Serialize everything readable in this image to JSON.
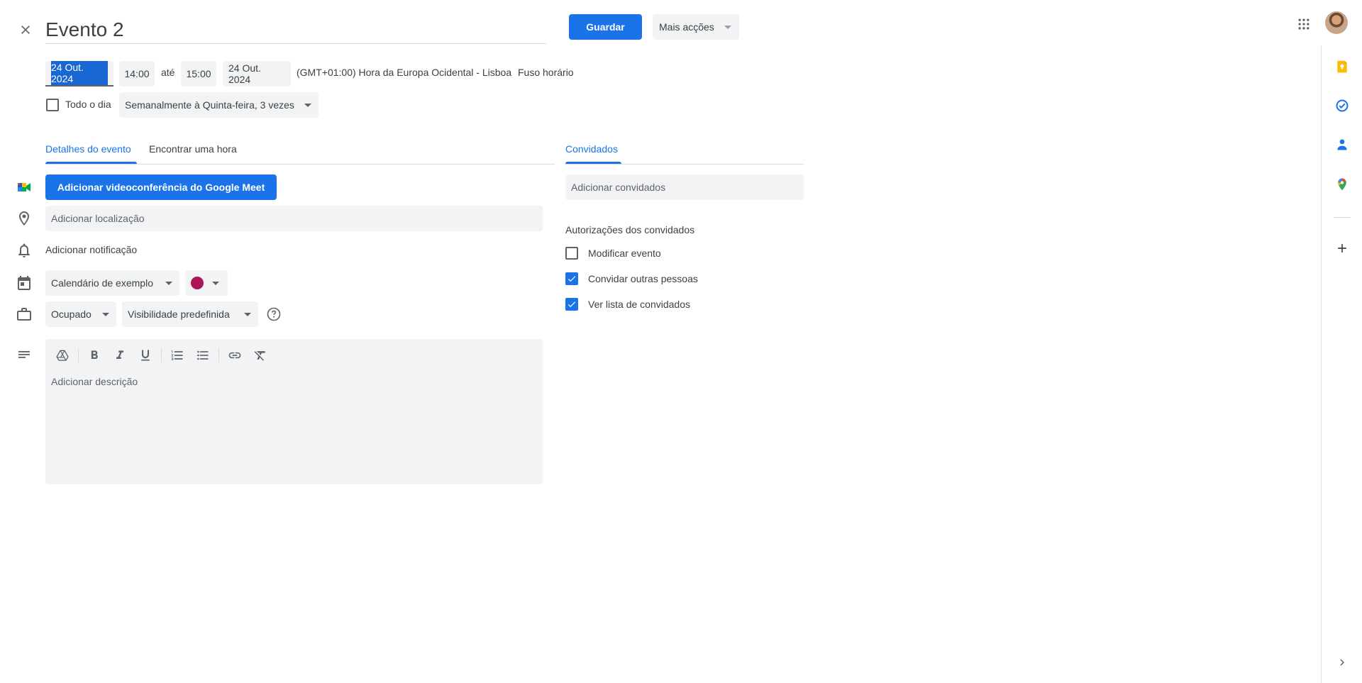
{
  "header": {
    "close_icon": "close-icon",
    "title": "Evento 2",
    "save_label": "Guardar",
    "more_actions_label": "Mais acções",
    "apps_icon": "apps-grid-icon"
  },
  "datetime": {
    "start_date": "24 Out. 2024",
    "start_time": "14:00",
    "until": "até",
    "end_time": "15:00",
    "end_date": "24 Out. 2024",
    "timezone": "(GMT+01:00) Hora da Europa Ocidental - Lisboa",
    "timezone_link": "Fuso horário",
    "all_day_label": "Todo o dia",
    "all_day_checked": false,
    "recurrence": "Semanalmente à Quinta-feira, 3 vezes"
  },
  "tabs": {
    "details": "Detalhes do evento",
    "find_time": "Encontrar uma hora",
    "guests": "Convidados"
  },
  "details": {
    "meet_button": "Adicionar videoconferência do Google Meet",
    "location_placeholder": "Adicionar localização",
    "notification_label": "Adicionar notificação",
    "calendar": "Calendário de exemplo",
    "event_color": "#ad1457",
    "availability": "Ocupado",
    "visibility": "Visibilidade predefinida",
    "description_placeholder": "Adicionar descrição"
  },
  "guests": {
    "add_placeholder": "Adicionar convidados",
    "permissions_title": "Autorizações dos convidados",
    "permissions": [
      {
        "label": "Modificar evento",
        "checked": false
      },
      {
        "label": "Convidar outras pessoas",
        "checked": true
      },
      {
        "label": "Ver lista de convidados",
        "checked": true
      }
    ]
  },
  "colors": {
    "accent": "#1a73e8",
    "surface": "#f1f3f4",
    "text": "#3c4043"
  }
}
